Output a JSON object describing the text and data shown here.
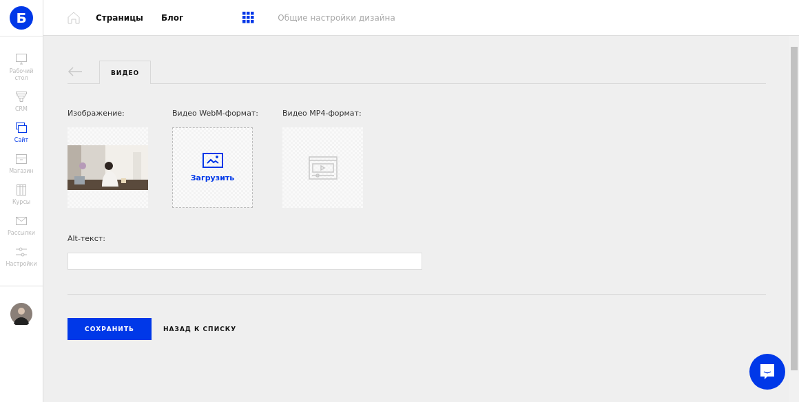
{
  "logo": {
    "letter": "Б"
  },
  "nav": {
    "links": [
      "Страницы",
      "Блог"
    ],
    "design_link": "Общие настройки дизайна"
  },
  "sidebar": {
    "items": [
      {
        "kind": "desktop",
        "label": "Рабочий стол",
        "selected": false
      },
      {
        "kind": "crm",
        "label": "CRM",
        "selected": false
      },
      {
        "kind": "site",
        "label": "Сайт",
        "selected": true
      },
      {
        "kind": "shop",
        "label": "Магазин",
        "selected": false
      },
      {
        "kind": "courses",
        "label": "Курсы",
        "selected": false
      },
      {
        "kind": "mail",
        "label": "Рассылки",
        "selected": false
      },
      {
        "kind": "settings",
        "label": "Настройки",
        "selected": false
      }
    ]
  },
  "tabs": [
    {
      "label": "ВИДЕО",
      "selected": true
    }
  ],
  "media": [
    {
      "kind": "picture",
      "label": "Изображение:"
    },
    {
      "kind": "upload",
      "label": "Видео WebM-формат:",
      "button": "Загрузить"
    },
    {
      "kind": "placeholder",
      "label": "Видео MP4-формат:"
    }
  ],
  "alt_text": {
    "label": "Alt-текст:"
  },
  "buttons": {
    "save": "СОХРАНИТЬ",
    "back": "НАЗАД К СПИСКУ"
  }
}
